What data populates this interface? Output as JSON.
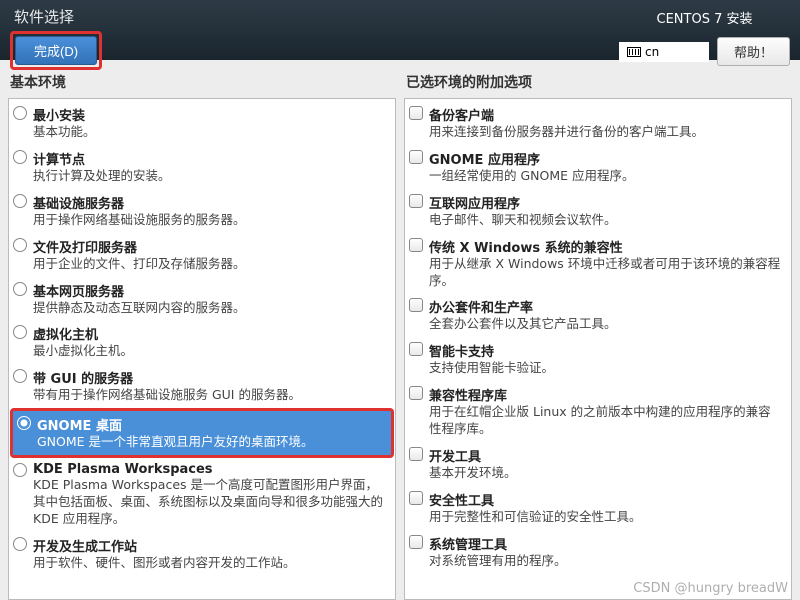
{
  "header": {
    "title": "软件选择",
    "done_label": "完成(D)",
    "installer_title": "CENTOS 7 安装",
    "keyboard_label": "cn",
    "help_label": "帮助！"
  },
  "left": {
    "heading": "基本环境",
    "items": [
      {
        "title": "最小安装",
        "desc": "基本功能。",
        "selected": false
      },
      {
        "title": "计算节点",
        "desc": "执行计算及处理的安装。",
        "selected": false
      },
      {
        "title": "基础设施服务器",
        "desc": "用于操作网络基础设施服务的服务器。",
        "selected": false
      },
      {
        "title": "文件及打印服务器",
        "desc": "用于企业的文件、打印及存储服务器。",
        "selected": false
      },
      {
        "title": "基本网页服务器",
        "desc": "提供静态及动态互联网内容的服务器。",
        "selected": false
      },
      {
        "title": "虚拟化主机",
        "desc": "最小虚拟化主机。",
        "selected": false
      },
      {
        "title": "带 GUI 的服务器",
        "desc": "带有用于操作网络基础设施服务 GUI 的服务器。",
        "selected": false
      },
      {
        "title": "GNOME 桌面",
        "desc": "GNOME 是一个非常直观且用户友好的桌面环境。",
        "selected": true
      },
      {
        "title": "KDE Plasma Workspaces",
        "desc": "KDE Plasma Workspaces 是一个高度可配置图形用户界面，其中包括面板、桌面、系统图标以及桌面向导和很多功能强大的 KDE 应用程序。",
        "selected": false
      },
      {
        "title": "开发及生成工作站",
        "desc": "用于软件、硬件、图形或者内容开发的工作站。",
        "selected": false
      }
    ]
  },
  "right": {
    "heading": "已选环境的附加选项",
    "items": [
      {
        "title": "备份客户端",
        "desc": "用来连接到备份服务器并进行备份的客户端工具。"
      },
      {
        "title": "GNOME 应用程序",
        "desc": "一组经常使用的 GNOME 应用程序。"
      },
      {
        "title": "互联网应用程序",
        "desc": "电子邮件、聊天和视频会议软件。"
      },
      {
        "title": "传统 X Windows 系统的兼容性",
        "desc": "用于从继承 X Windows 环境中迁移或者可用于该环境的兼容程序。"
      },
      {
        "title": "办公套件和生产率",
        "desc": "全套办公套件以及其它产品工具。"
      },
      {
        "title": "智能卡支持",
        "desc": "支持使用智能卡验证。"
      },
      {
        "title": "兼容性程序库",
        "desc": "用于在红帽企业版 Linux 的之前版本中构建的应用程序的兼容性程序库。"
      },
      {
        "title": "开发工具",
        "desc": "基本开发环境。"
      },
      {
        "title": "安全性工具",
        "desc": "用于完整性和可信验证的安全性工具。"
      },
      {
        "title": "系统管理工具",
        "desc": "对系统管理有用的程序。"
      }
    ]
  },
  "watermark": "CSDN @hungry breadW"
}
